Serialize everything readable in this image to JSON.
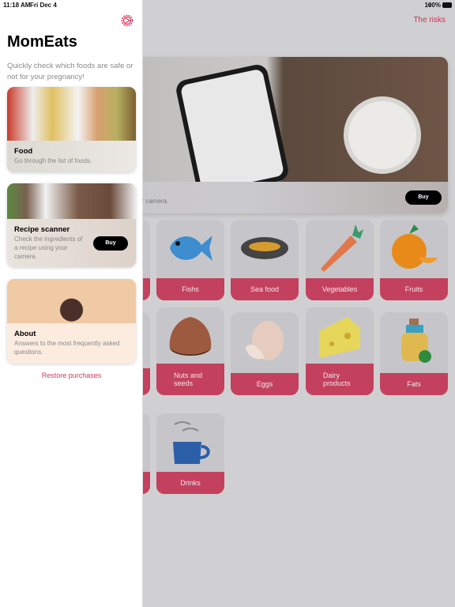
{
  "status": {
    "time": "11:18 AM",
    "date": "Fri Dec 4",
    "battery": "100%"
  },
  "header": {
    "risks_link": "The risks"
  },
  "banner": {
    "text": "ur camera.",
    "buy_label": "Buy"
  },
  "categories": [
    {
      "label": "Fishs",
      "icon": "fish-icon"
    },
    {
      "label": "Sea food",
      "icon": "mussel-icon"
    },
    {
      "label": "Vegetables",
      "icon": "carrot-icon"
    },
    {
      "label": "Fruits",
      "icon": "orange-icon"
    },
    {
      "label": "Nuts and seeds",
      "icon": "nut-icon"
    },
    {
      "label": "Eggs",
      "icon": "egg-icon"
    },
    {
      "label": "Dairy products",
      "icon": "cheese-icon"
    },
    {
      "label": "Fats",
      "icon": "oil-bottle-icon"
    },
    {
      "label": "Drinks",
      "icon": "coffee-cup-icon"
    }
  ],
  "sidebar": {
    "title": "MomEats",
    "subtitle": "Quickly check which foods are safe or not for your pregnancy!",
    "cards": [
      {
        "title": "Food",
        "desc": "Go through the list of foods."
      },
      {
        "title": "Recipe scanner",
        "desc": "Check the ingredients of a recipe using your camera.",
        "buy_label": "Buy"
      },
      {
        "title": "About",
        "desc": "Answers to the most frequently asked questions."
      }
    ],
    "restore": "Restore purchases"
  },
  "colors": {
    "accent": "#d6375a",
    "tile_label": "#c3415e"
  }
}
